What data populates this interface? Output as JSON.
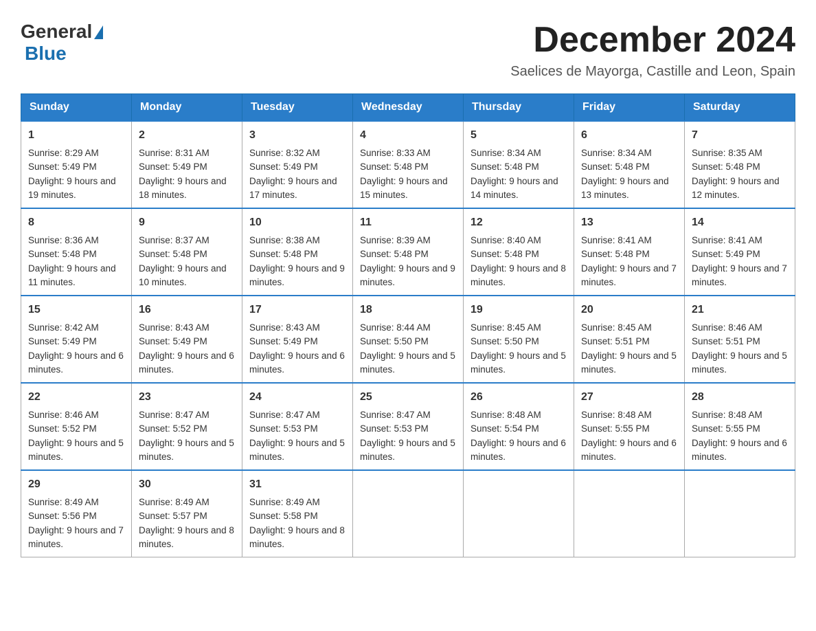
{
  "header": {
    "logo_general": "General",
    "logo_blue": "Blue",
    "month_title": "December 2024",
    "location": "Saelices de Mayorga, Castille and Leon, Spain"
  },
  "days_of_week": [
    "Sunday",
    "Monday",
    "Tuesday",
    "Wednesday",
    "Thursday",
    "Friday",
    "Saturday"
  ],
  "weeks": [
    [
      {
        "day": "1",
        "sunrise": "8:29 AM",
        "sunset": "5:49 PM",
        "daylight": "9 hours and 19 minutes."
      },
      {
        "day": "2",
        "sunrise": "8:31 AM",
        "sunset": "5:49 PM",
        "daylight": "9 hours and 18 minutes."
      },
      {
        "day": "3",
        "sunrise": "8:32 AM",
        "sunset": "5:49 PM",
        "daylight": "9 hours and 17 minutes."
      },
      {
        "day": "4",
        "sunrise": "8:33 AM",
        "sunset": "5:48 PM",
        "daylight": "9 hours and 15 minutes."
      },
      {
        "day": "5",
        "sunrise": "8:34 AM",
        "sunset": "5:48 PM",
        "daylight": "9 hours and 14 minutes."
      },
      {
        "day": "6",
        "sunrise": "8:34 AM",
        "sunset": "5:48 PM",
        "daylight": "9 hours and 13 minutes."
      },
      {
        "day": "7",
        "sunrise": "8:35 AM",
        "sunset": "5:48 PM",
        "daylight": "9 hours and 12 minutes."
      }
    ],
    [
      {
        "day": "8",
        "sunrise": "8:36 AM",
        "sunset": "5:48 PM",
        "daylight": "9 hours and 11 minutes."
      },
      {
        "day": "9",
        "sunrise": "8:37 AM",
        "sunset": "5:48 PM",
        "daylight": "9 hours and 10 minutes."
      },
      {
        "day": "10",
        "sunrise": "8:38 AM",
        "sunset": "5:48 PM",
        "daylight": "9 hours and 9 minutes."
      },
      {
        "day": "11",
        "sunrise": "8:39 AM",
        "sunset": "5:48 PM",
        "daylight": "9 hours and 9 minutes."
      },
      {
        "day": "12",
        "sunrise": "8:40 AM",
        "sunset": "5:48 PM",
        "daylight": "9 hours and 8 minutes."
      },
      {
        "day": "13",
        "sunrise": "8:41 AM",
        "sunset": "5:48 PM",
        "daylight": "9 hours and 7 minutes."
      },
      {
        "day": "14",
        "sunrise": "8:41 AM",
        "sunset": "5:49 PM",
        "daylight": "9 hours and 7 minutes."
      }
    ],
    [
      {
        "day": "15",
        "sunrise": "8:42 AM",
        "sunset": "5:49 PM",
        "daylight": "9 hours and 6 minutes."
      },
      {
        "day": "16",
        "sunrise": "8:43 AM",
        "sunset": "5:49 PM",
        "daylight": "9 hours and 6 minutes."
      },
      {
        "day": "17",
        "sunrise": "8:43 AM",
        "sunset": "5:49 PM",
        "daylight": "9 hours and 6 minutes."
      },
      {
        "day": "18",
        "sunrise": "8:44 AM",
        "sunset": "5:50 PM",
        "daylight": "9 hours and 5 minutes."
      },
      {
        "day": "19",
        "sunrise": "8:45 AM",
        "sunset": "5:50 PM",
        "daylight": "9 hours and 5 minutes."
      },
      {
        "day": "20",
        "sunrise": "8:45 AM",
        "sunset": "5:51 PM",
        "daylight": "9 hours and 5 minutes."
      },
      {
        "day": "21",
        "sunrise": "8:46 AM",
        "sunset": "5:51 PM",
        "daylight": "9 hours and 5 minutes."
      }
    ],
    [
      {
        "day": "22",
        "sunrise": "8:46 AM",
        "sunset": "5:52 PM",
        "daylight": "9 hours and 5 minutes."
      },
      {
        "day": "23",
        "sunrise": "8:47 AM",
        "sunset": "5:52 PM",
        "daylight": "9 hours and 5 minutes."
      },
      {
        "day": "24",
        "sunrise": "8:47 AM",
        "sunset": "5:53 PM",
        "daylight": "9 hours and 5 minutes."
      },
      {
        "day": "25",
        "sunrise": "8:47 AM",
        "sunset": "5:53 PM",
        "daylight": "9 hours and 5 minutes."
      },
      {
        "day": "26",
        "sunrise": "8:48 AM",
        "sunset": "5:54 PM",
        "daylight": "9 hours and 6 minutes."
      },
      {
        "day": "27",
        "sunrise": "8:48 AM",
        "sunset": "5:55 PM",
        "daylight": "9 hours and 6 minutes."
      },
      {
        "day": "28",
        "sunrise": "8:48 AM",
        "sunset": "5:55 PM",
        "daylight": "9 hours and 6 minutes."
      }
    ],
    [
      {
        "day": "29",
        "sunrise": "8:49 AM",
        "sunset": "5:56 PM",
        "daylight": "9 hours and 7 minutes."
      },
      {
        "day": "30",
        "sunrise": "8:49 AM",
        "sunset": "5:57 PM",
        "daylight": "9 hours and 8 minutes."
      },
      {
        "day": "31",
        "sunrise": "8:49 AM",
        "sunset": "5:58 PM",
        "daylight": "9 hours and 8 minutes."
      },
      null,
      null,
      null,
      null
    ]
  ]
}
